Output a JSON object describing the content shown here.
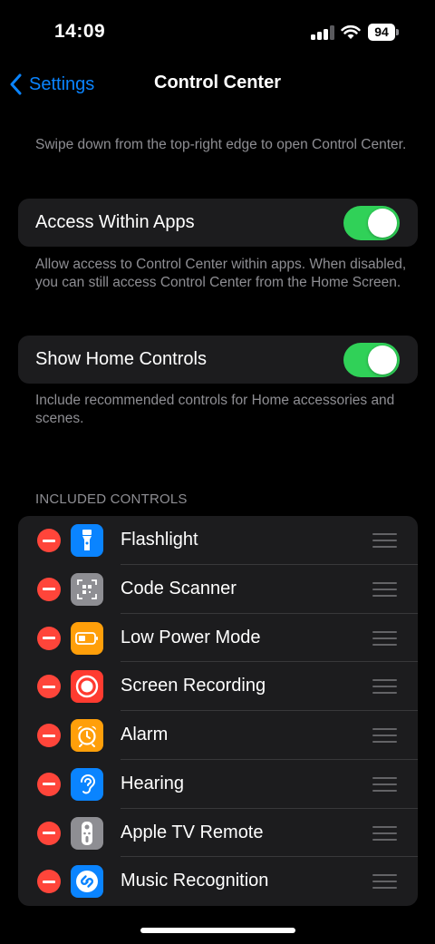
{
  "status_bar": {
    "time": "14:09",
    "battery": "94"
  },
  "nav": {
    "back_label": "Settings",
    "title": "Control Center"
  },
  "intro_text": "Swipe down from the top-right edge to open Control Center.",
  "access_within_apps": {
    "label": "Access Within Apps",
    "enabled": true,
    "footnote": "Allow access to Control Center within apps. When disabled, you can still access Control Center from the Home Screen."
  },
  "show_home_controls": {
    "label": "Show Home Controls",
    "enabled": true,
    "footnote": "Include recommended controls for Home accessories and scenes."
  },
  "included_controls": {
    "header": "INCLUDED CONTROLS",
    "items": [
      {
        "label": "Flashlight",
        "icon": "flashlight-icon",
        "color": "#0a84ff"
      },
      {
        "label": "Code Scanner",
        "icon": "qr-code-icon",
        "color": "#8e8e93"
      },
      {
        "label": "Low Power Mode",
        "icon": "battery-icon",
        "color": "#ff9f0a"
      },
      {
        "label": "Screen Recording",
        "icon": "record-icon",
        "color": "#ff3b30"
      },
      {
        "label": "Alarm",
        "icon": "alarm-clock-icon",
        "color": "#ff9f0a"
      },
      {
        "label": "Hearing",
        "icon": "ear-icon",
        "color": "#0a84ff"
      },
      {
        "label": "Apple TV Remote",
        "icon": "tv-remote-icon",
        "color": "#8e8e93"
      },
      {
        "label": "Music Recognition",
        "icon": "shazam-icon",
        "color": "#0a84ff"
      }
    ]
  },
  "colors": {
    "accent": "#0a84ff",
    "toggle_on": "#30d158",
    "remove": "#ff453a"
  }
}
